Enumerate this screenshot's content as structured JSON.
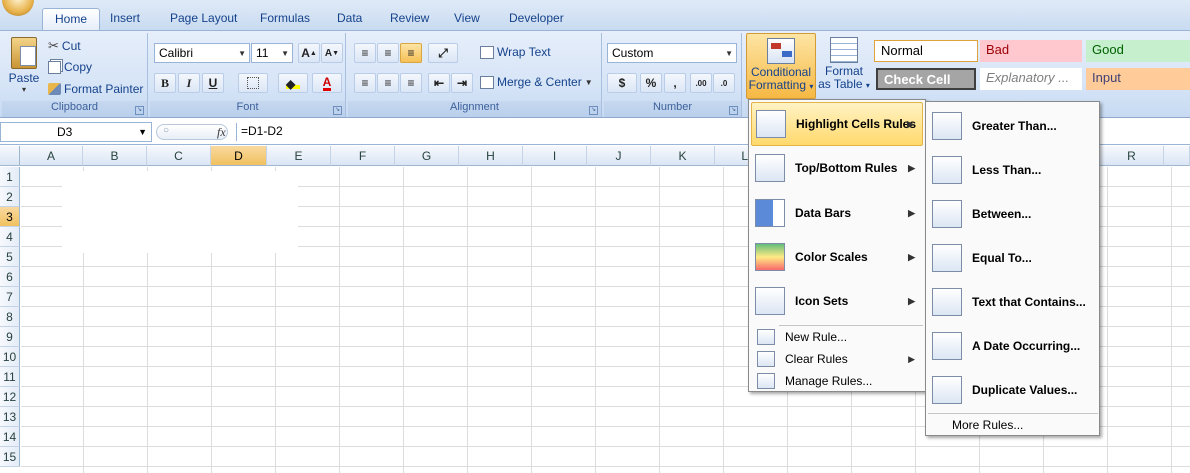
{
  "tabs": [
    "Home",
    "Insert",
    "Page Layout",
    "Formulas",
    "Data",
    "Review",
    "View",
    "Developer"
  ],
  "clipboard": {
    "paste": "Paste",
    "cut": "Cut",
    "copy": "Copy",
    "format_painter": "Format Painter",
    "label": "Clipboard"
  },
  "font": {
    "name": "Calibri",
    "size": "11",
    "bold": "B",
    "italic": "I",
    "underline": "U",
    "grow": "A",
    "shrink": "A",
    "color": "A",
    "label": "Font"
  },
  "alignment": {
    "wrap": "Wrap Text",
    "merge": "Merge & Center",
    "label": "Alignment"
  },
  "number": {
    "format": "Custom",
    "currency": "$",
    "percent": "%",
    "comma": ",",
    "inc": ".00",
    "dec": ".0",
    "label": "Number"
  },
  "styles_group": {
    "conditional_1": "Conditional",
    "conditional_2": "Formatting",
    "format_1": "Format",
    "format_2": "as Table"
  },
  "styles": {
    "normal": "Normal",
    "bad": "Bad",
    "good": "Good",
    "check": "Check Cell",
    "explanatory": "Explanatory ...",
    "input": "Input"
  },
  "formula_bar": {
    "name_box": "D3",
    "fx": "fx",
    "formula": "=D1-D2"
  },
  "columns": [
    "A",
    "B",
    "C",
    "D",
    "E",
    "F",
    "G",
    "H",
    "I",
    "J",
    "K",
    "L",
    "R"
  ],
  "rows": [
    "1",
    "2",
    "3",
    "4",
    "5",
    "6",
    "7",
    "8",
    "9",
    "10",
    "11",
    "12",
    "13",
    "14",
    "15"
  ],
  "menu": {
    "highlight": "Highlight Cells Rules",
    "topbottom": "Top/Bottom Rules",
    "databars": "Data Bars",
    "colorscales": "Color Scales",
    "iconsets": "Icon Sets",
    "new_rule": "New Rule...",
    "clear_rules": "Clear Rules",
    "manage_rules": "Manage Rules..."
  },
  "submenu": {
    "greater": "Greater Than...",
    "less": "Less Than...",
    "between": "Between...",
    "equal": "Equal To...",
    "text": "Text that Contains...",
    "date": "A Date Occurring...",
    "duplicate": "Duplicate Values...",
    "more": "More Rules..."
  }
}
